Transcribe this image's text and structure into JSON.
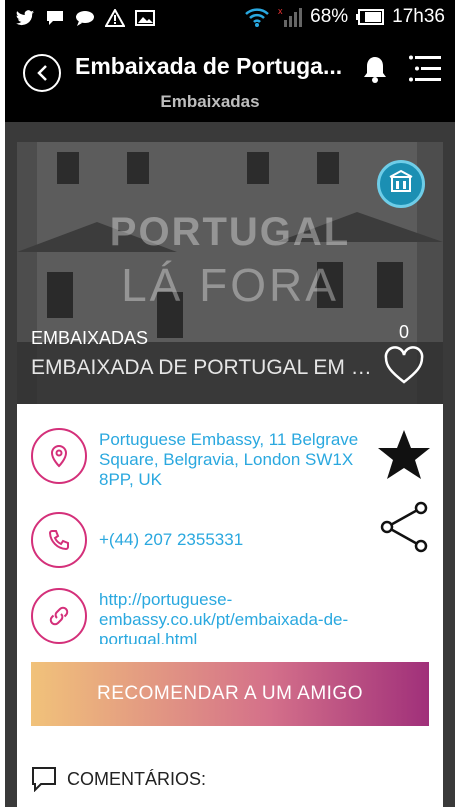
{
  "status_bar": {
    "battery": "68%",
    "time": "17h36"
  },
  "header": {
    "title": "Embaixada de Portuga...",
    "subtitle": "Embaixadas"
  },
  "hero": {
    "watermark_line1": "PORTUGAL",
    "watermark_line2": "LÁ FORA",
    "category": "EMBAIXADAS",
    "name": "EMBAIXADA DE PORTUGAL EM L...",
    "like_count": "0"
  },
  "info": {
    "address": "Portuguese Embassy, 11 Belgrave Square, Belgravia, London SW1X 8PP, UK",
    "phone": "+(44) 207 2355331",
    "website": "http://portuguese-embassy.co.uk/pt/embaixada-de-portugal.html"
  },
  "actions": {
    "recommend_label": "RECOMENDAR A UM AMIGO",
    "comments_label": "COMENTÁRIOS:"
  },
  "colors": {
    "accent_pink": "#d4307a",
    "link_blue": "#2aa8df",
    "gradient_start": "#f1c27a",
    "gradient_end": "#a0307a"
  }
}
